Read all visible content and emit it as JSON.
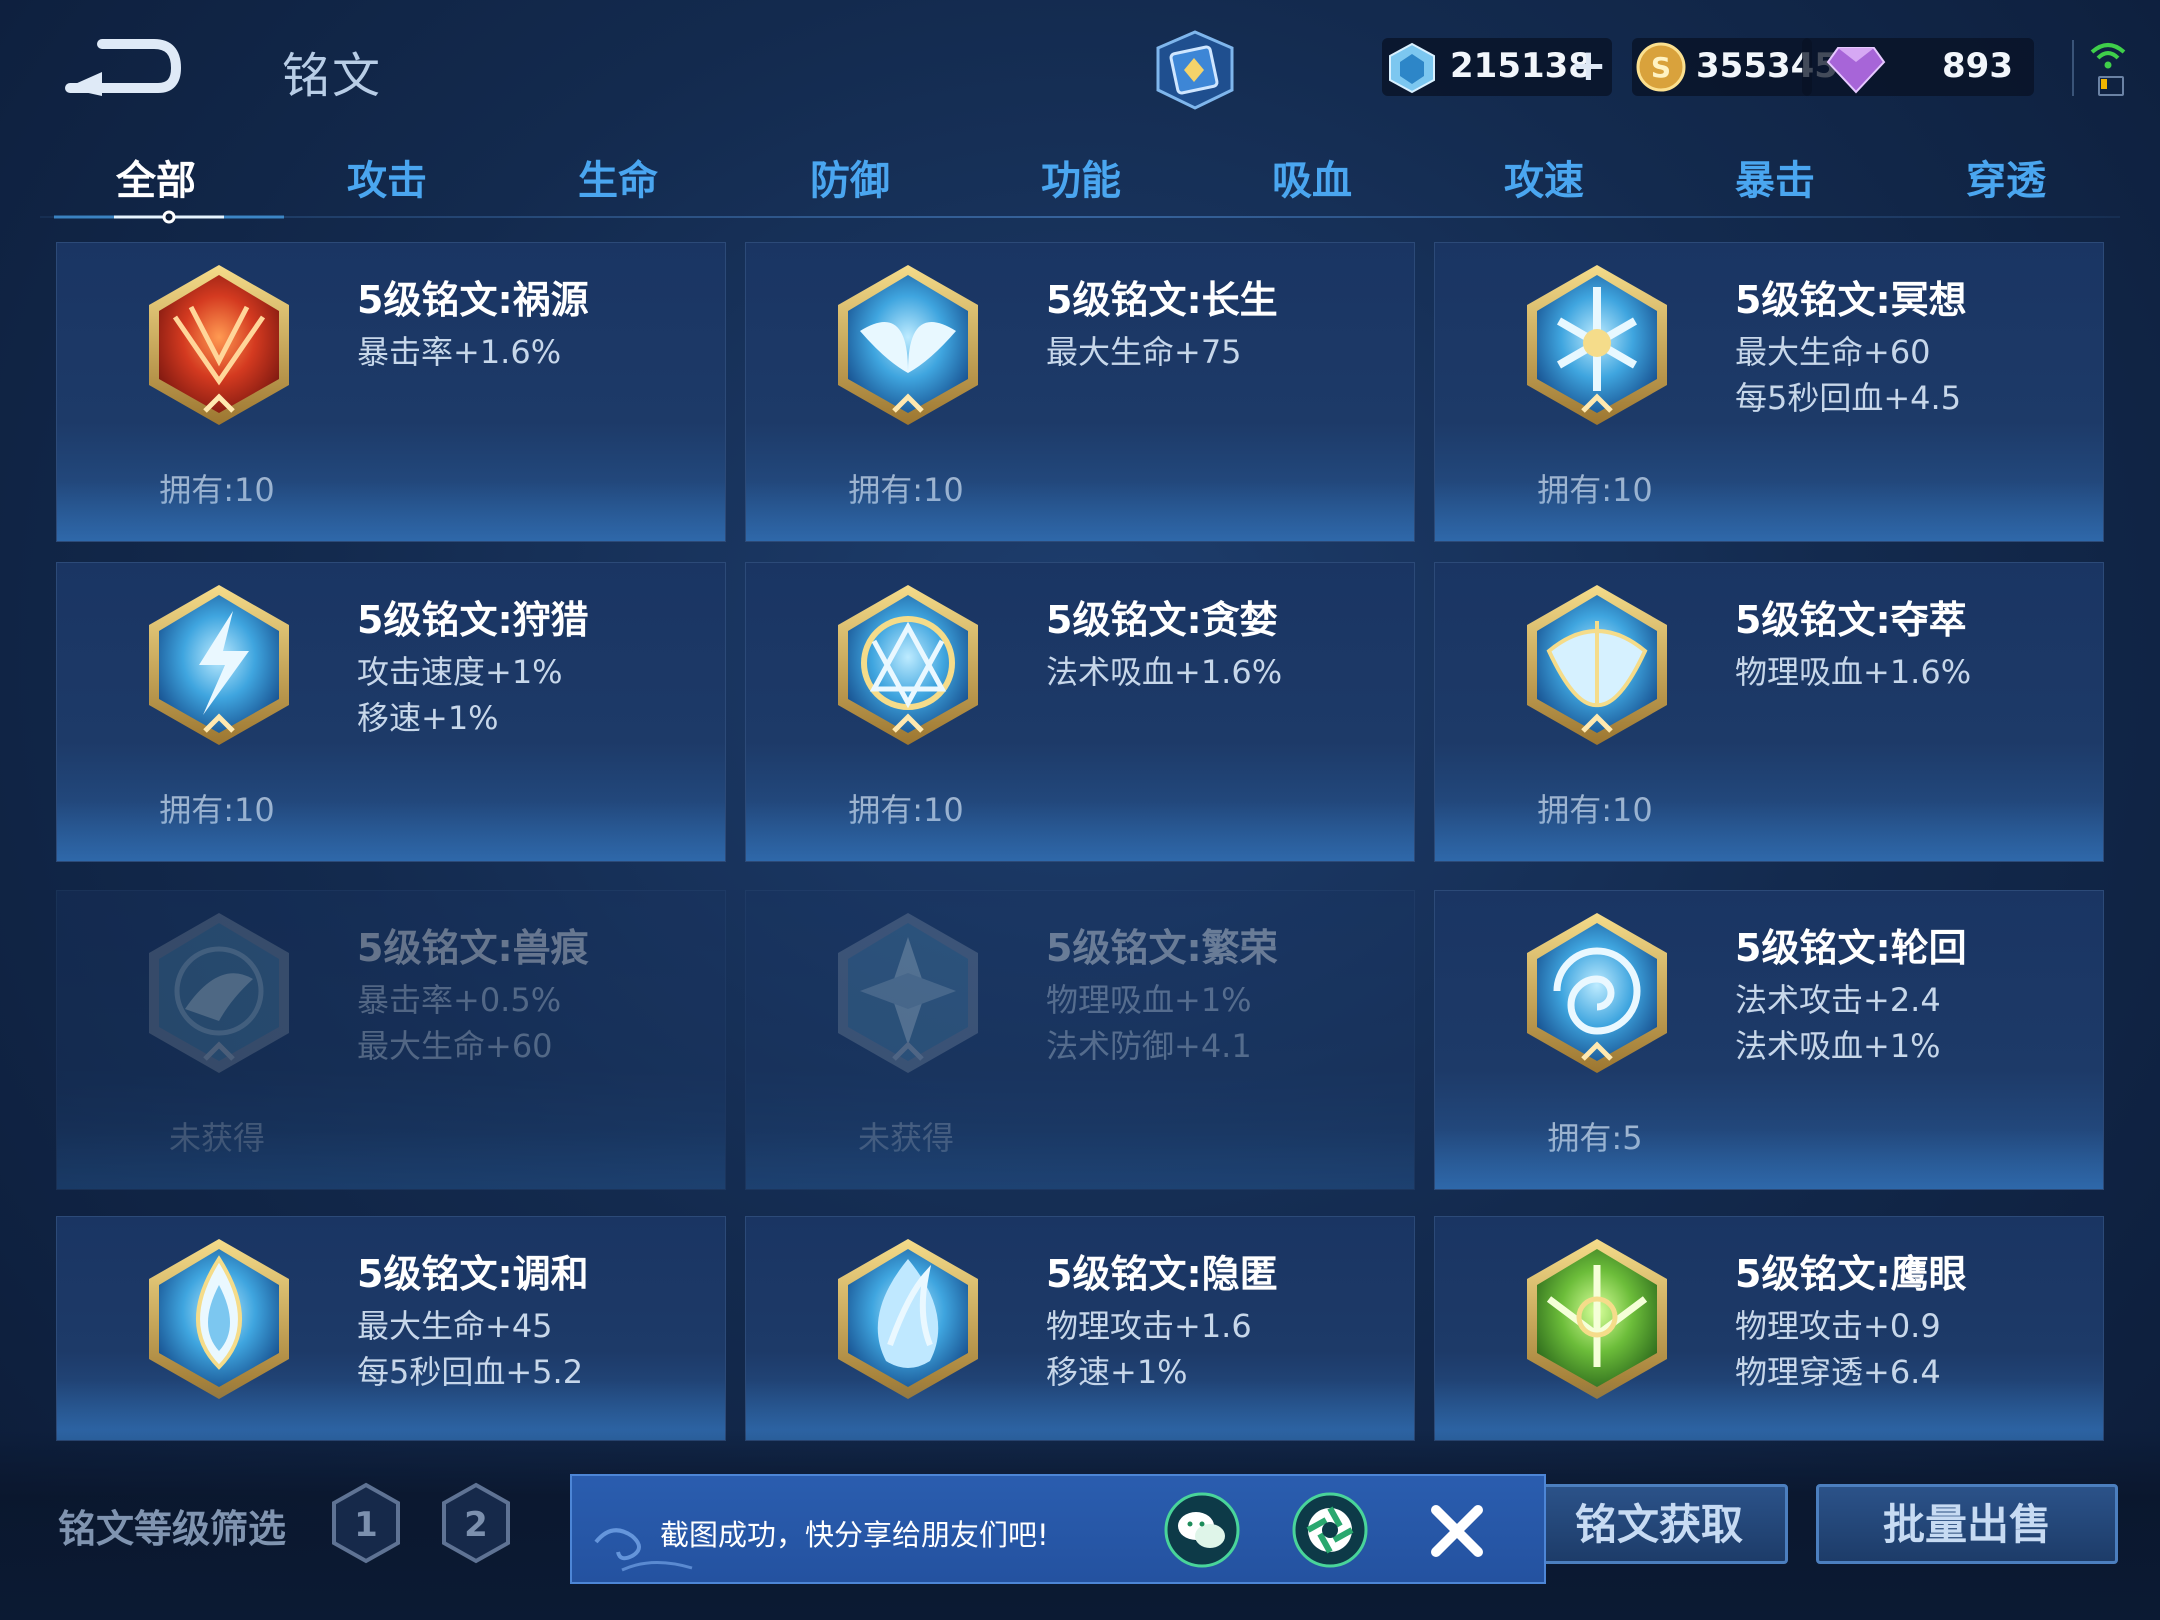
{
  "header": {
    "title": "铭文",
    "resources": {
      "crystal": "215138",
      "coin": "355345",
      "gem": "893"
    }
  },
  "tabs": [
    "全部",
    "攻击",
    "生命",
    "防御",
    "功能",
    "吸血",
    "攻速",
    "暴击",
    "穿透"
  ],
  "active_tab": "全部",
  "cards": [
    {
      "name": "5级铭文:祸源",
      "stats": [
        "暴击率+1.6%",
        ""
      ],
      "owned": "拥有:10",
      "theme": "red"
    },
    {
      "name": "5级铭文:长生",
      "stats": [
        "最大生命+75",
        ""
      ],
      "owned": "拥有:10",
      "theme": "blue"
    },
    {
      "name": "5级铭文:冥想",
      "stats": [
        "最大生命+60",
        "每5秒回血+4.5"
      ],
      "owned": "拥有:10",
      "theme": "blue"
    },
    {
      "name": "5级铭文:狩猎",
      "stats": [
        "攻击速度+1%",
        "移速+1%"
      ],
      "owned": "拥有:10",
      "theme": "blue"
    },
    {
      "name": "5级铭文:贪婪",
      "stats": [
        "法术吸血+1.6%",
        ""
      ],
      "owned": "拥有:10",
      "theme": "blue"
    },
    {
      "name": "5级铭文:夺萃",
      "stats": [
        "物理吸血+1.6%",
        ""
      ],
      "owned": "拥有:10",
      "theme": "blue"
    },
    {
      "name": "5级铭文:兽痕",
      "stats": [
        "暴击率+0.5%",
        "最大生命+60"
      ],
      "owned": "未获得",
      "theme": "blue"
    },
    {
      "name": "5级铭文:繁荣",
      "stats": [
        "物理吸血+1%",
        "法术防御+4.1"
      ],
      "owned": "未获得",
      "theme": "blue"
    },
    {
      "name": "5级铭文:轮回",
      "stats": [
        "法术攻击+2.4",
        "法术吸血+1%"
      ],
      "owned": "拥有:5",
      "theme": "blue"
    },
    {
      "name": "5级铭文:调和",
      "stats": [
        "最大生命+45",
        "每5秒回血+5.2"
      ],
      "owned": "",
      "theme": "blue"
    },
    {
      "name": "5级铭文:隐匿",
      "stats": [
        "物理攻击+1.6",
        "移速+1%"
      ],
      "owned": "",
      "theme": "blue"
    },
    {
      "name": "5级铭文:鹰眼",
      "stats": [
        "物理攻击+0.9",
        "物理穿透+6.4"
      ],
      "owned": "",
      "theme": "green"
    }
  ],
  "bottom": {
    "filter_label": "铭文等级筛选",
    "levels": [
      "1",
      "2"
    ],
    "get_button": "铭文获取",
    "sell_button": "批量出售"
  },
  "toast": {
    "message": "截图成功，快分享给朋友们吧!"
  },
  "icons": {
    "back": "back-arrow-icon",
    "book": "rune-book-icon",
    "crystal": "crystal-icon",
    "coin": "coin-icon",
    "gem": "diamond-icon",
    "wifi": "wifi-icon",
    "battery": "battery-icon",
    "wechat": "wechat-icon",
    "moments": "moments-icon",
    "close": "close-icon"
  },
  "colors": {
    "tab_text": "#4aa6f0",
    "tab_active": "#ffffff",
    "red_emblem": "#c8341e",
    "blue_emblem": "#4fb8e6",
    "green_emblem": "#6fbf3a",
    "gold_frame": "#c9a24a"
  }
}
